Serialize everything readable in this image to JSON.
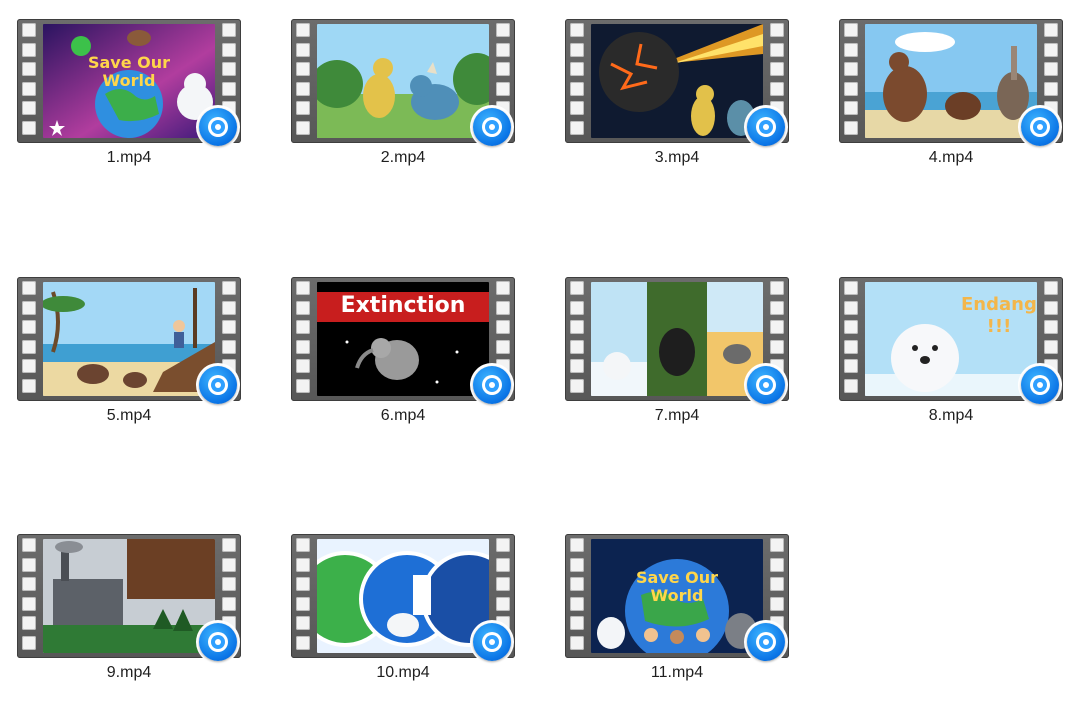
{
  "files": [
    {
      "name": "1.mp4",
      "thumb_text": "Save Our World",
      "thumb_colors": [
        "#3b1a6e",
        "#d64aa8"
      ]
    },
    {
      "name": "2.mp4",
      "thumb_text": "",
      "thumb_colors": [
        "#8fd0f0",
        "#7cb85a"
      ]
    },
    {
      "name": "3.mp4",
      "thumb_text": "",
      "thumb_colors": [
        "#0e1b33",
        "#3a4a6a"
      ]
    },
    {
      "name": "4.mp4",
      "thumb_text": "",
      "thumb_colors": [
        "#87c9f2",
        "#e6d7a6"
      ]
    },
    {
      "name": "5.mp4",
      "thumb_text": "",
      "thumb_colors": [
        "#9fd6f5",
        "#e9d6a0"
      ]
    },
    {
      "name": "6.mp4",
      "thumb_text": "Extinction",
      "thumb_colors": [
        "#000000",
        "#111111"
      ]
    },
    {
      "name": "7.mp4",
      "thumb_text": "",
      "thumb_colors": [
        "#a8d6f0",
        "#3f6b2c"
      ]
    },
    {
      "name": "8.mp4",
      "thumb_text": "Endangered !!!",
      "thumb_colors": [
        "#a9dcf7",
        "#e5f3fb"
      ]
    },
    {
      "name": "9.mp4",
      "thumb_text": "",
      "thumb_colors": [
        "#7a7f86",
        "#3a7a3a"
      ]
    },
    {
      "name": "10.mp4",
      "thumb_text": "",
      "thumb_colors": [
        "#eaf4ff",
        "#1c6bd8"
      ]
    },
    {
      "name": "11.mp4",
      "thumb_text": "Save Our World",
      "thumb_colors": [
        "#0b1f4d",
        "#2c7ad9"
      ]
    }
  ],
  "icons": {
    "strip": "film-strip-icon",
    "badge": "media-player-icon"
  },
  "colors": {
    "accent": "#0a74e6",
    "text": "#1f1f1f",
    "strip": "#616161"
  }
}
